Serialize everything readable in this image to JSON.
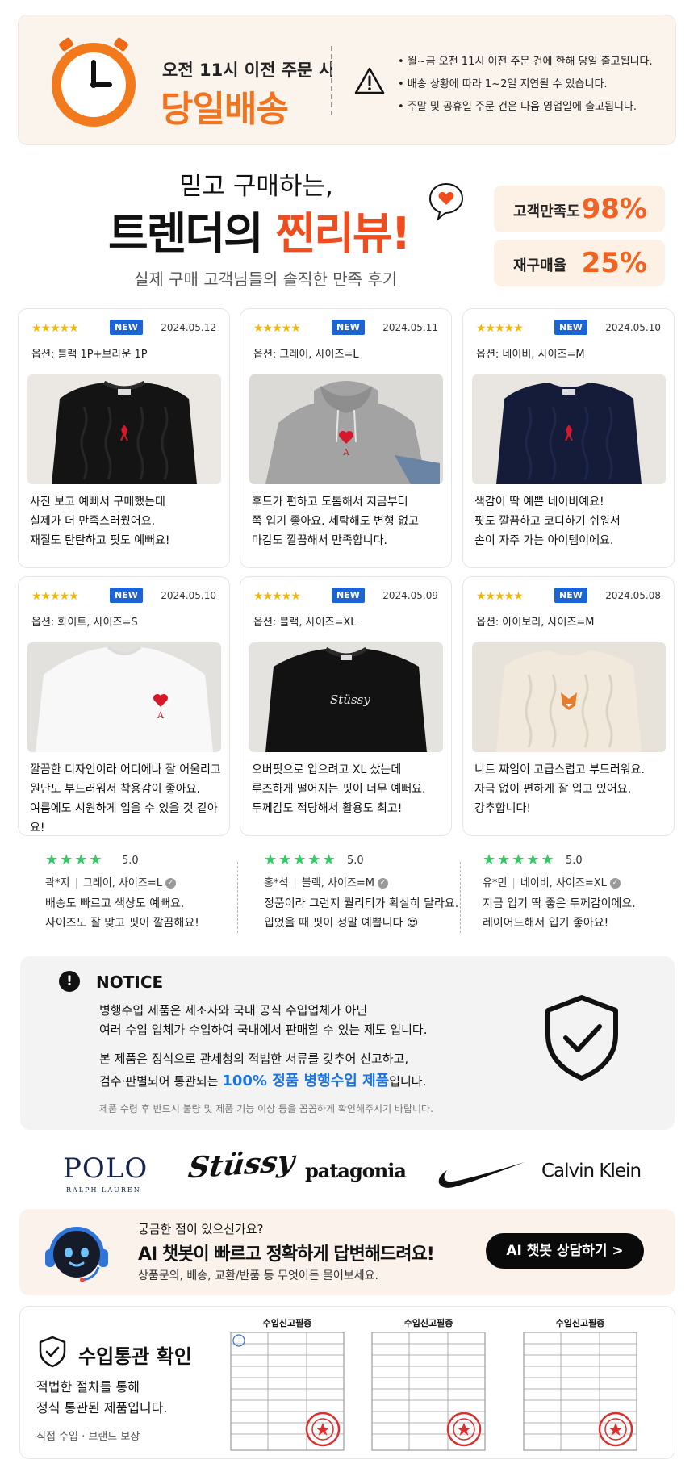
{
  "delivery": {
    "subtitle": "오전 11시 이전 주문 시",
    "title": "당일배송",
    "notes": [
      "월~금 오전 11시 이전 주문 건에 한해 당일 출고됩니다.",
      "배송 상황에 따라 1~2일 지연될 수 있습니다.",
      "주말 및 공휴일 주문 건은 다음 영업일에 출고됩니다."
    ]
  },
  "review_header": {
    "top": "믿고 구매하는,",
    "main_prefix": "트렌더의 ",
    "main_highlight": "찐리뷰!",
    "sub": "실제 구매 고객님들의 솔직한 만족 후기"
  },
  "stats": [
    {
      "label": "고객만족도",
      "value": "98%"
    },
    {
      "label": "재구매율",
      "value": "25%"
    }
  ],
  "colors": {
    "accent": "#f3731e",
    "highlight": "#f04d1f",
    "new_badge": "#1c63d5",
    "star": "#f7b600",
    "green_star": "#2ecc63",
    "link_blue": "#1b74e4"
  },
  "reviews": [
    {
      "stars": "★★★★★",
      "badge": "NEW",
      "date": "2024.05.12",
      "option": "옵션: 블랙 1P+브라운 1P",
      "image": "black-cable-sweater",
      "lines": [
        "사진 보고 예뻐서 구매했는데",
        "실제가 더 만족스러웠어요.",
        "재질도 탄탄하고 핏도 예뻐요!"
      ]
    },
    {
      "stars": "★★★★★",
      "badge": "NEW",
      "date": "2024.05.11",
      "option": "옵션: 그레이, 사이즈=L",
      "image": "grey-hoodie",
      "lines": [
        "후드가 편하고 도톰해서 지금부터",
        "쭉 입기 좋아요. 세탁해도 변형 없고",
        "마감도 깔끔해서 만족합니다."
      ]
    },
    {
      "stars": "★★★★★",
      "badge": "NEW",
      "date": "2024.05.10",
      "option": "옵션: 네이비, 사이즈=M",
      "image": "navy-cable-sweater",
      "lines": [
        "색감이 딱 예쁜 네이비예요!",
        "핏도 깔끔하고 코디하기 쉬워서",
        "손이 자주 가는 아이템이에요."
      ]
    },
    {
      "stars": "★★★★★",
      "badge": "NEW",
      "date": "2024.05.10",
      "option": "옵션: 화이트, 사이즈=S",
      "image": "white-tshirt",
      "lines": [
        "깔끔한 디자인이라 어디에나 잘 어울리고",
        "원단도 부드러워서 착용감이 좋아요.",
        "여름에도 시원하게 입을 수 있을 것 같아요!"
      ]
    },
    {
      "stars": "★★★★★",
      "badge": "NEW",
      "date": "2024.05.09",
      "option": "옵션: 블랙, 사이즈=XL",
      "image": "black-sweatshirt",
      "lines": [
        "오버핏으로 입으려고 XL 샀는데",
        "루즈하게 떨어지는 핏이 너무 예뻐요.",
        "두께감도 적당해서 활용도 최고!"
      ]
    },
    {
      "stars": "★★★★★",
      "badge": "NEW",
      "date": "2024.05.08",
      "option": "옵션: 아이보리, 사이즈=M",
      "image": "ivory-knit",
      "lines": [
        "니트 짜임이 고급스럽고 부드러워요.",
        "자극 없이 편하게 잘 입고 있어요.",
        "강추합니다!"
      ]
    }
  ],
  "short_reviews": [
    {
      "stars": "★★★★",
      "score": "5.0",
      "user": "곽*지",
      "option": "그레이, 사이즈=L",
      "line1": "배송도 빠르고 색상도 예뻐요.",
      "line2": "사이즈도 잘 맞고 핏이 깔끔해요!"
    },
    {
      "stars": "★★★★★",
      "score": "5.0",
      "user": "홍*석",
      "option": "블랙, 사이즈=M",
      "line1": "정품이라 그런지 퀄리티가 확실히 달라요.",
      "line2": "입었을 때 핏이 정말 예쁩니다 😍"
    },
    {
      "stars": "★★★★★",
      "score": "5.0",
      "user": "유*민",
      "option": "네이비, 사이즈=XL",
      "line1": "지금 입기 딱 좋은 두께감이에요.",
      "line2": "레이어드해서 입기 좋아요!"
    }
  ],
  "notice": {
    "title": "NOTICE",
    "line1": "병행수입 제품은 제조사와 국내 공식 수입업체가 아닌",
    "line2": "여러 수입 업체가 수입하여 국내에서 판매할 수 있는 제도 입니다.",
    "line3": "본 제품은 정식으로 관세청의 적법한 서류를 갖추어 신고하고,",
    "line4_prefix": "검수·판별되어 통관되는 ",
    "line4_highlight": "100% 정품 병행수입 제품",
    "line4_suffix": "입니다.",
    "fine": "제품 수령 후 반드시 불량 및 제품 기능 이상 등을 꼼꼼하게 확인해주시기 바랍니다."
  },
  "brands": {
    "polo": "POLO",
    "polo_sub": "RALPH LAUREN",
    "stussy": "Stüssy",
    "patagonia": "patagonia",
    "nike": "nike-swoosh",
    "ck": "Calvin Klein"
  },
  "chatbot": {
    "question": "궁금한 점이 있으신가요?",
    "main": "AI 챗봇이 빠르고 정확하게 답변해드려요!",
    "sub": "상품문의, 배송, 교환/반품 등 무엇이든 물어보세요.",
    "button": "AI 챗봇 상담하기 >"
  },
  "customs": {
    "title": "수입통관 확인",
    "line1": "적법한 절차를 통해",
    "line2": "정식 통관된 제품입니다.",
    "fine": "직접 수입 · 브랜드 보장",
    "docs": [
      "수입신고필증",
      "수입신고필증",
      "수입신고필증"
    ]
  }
}
